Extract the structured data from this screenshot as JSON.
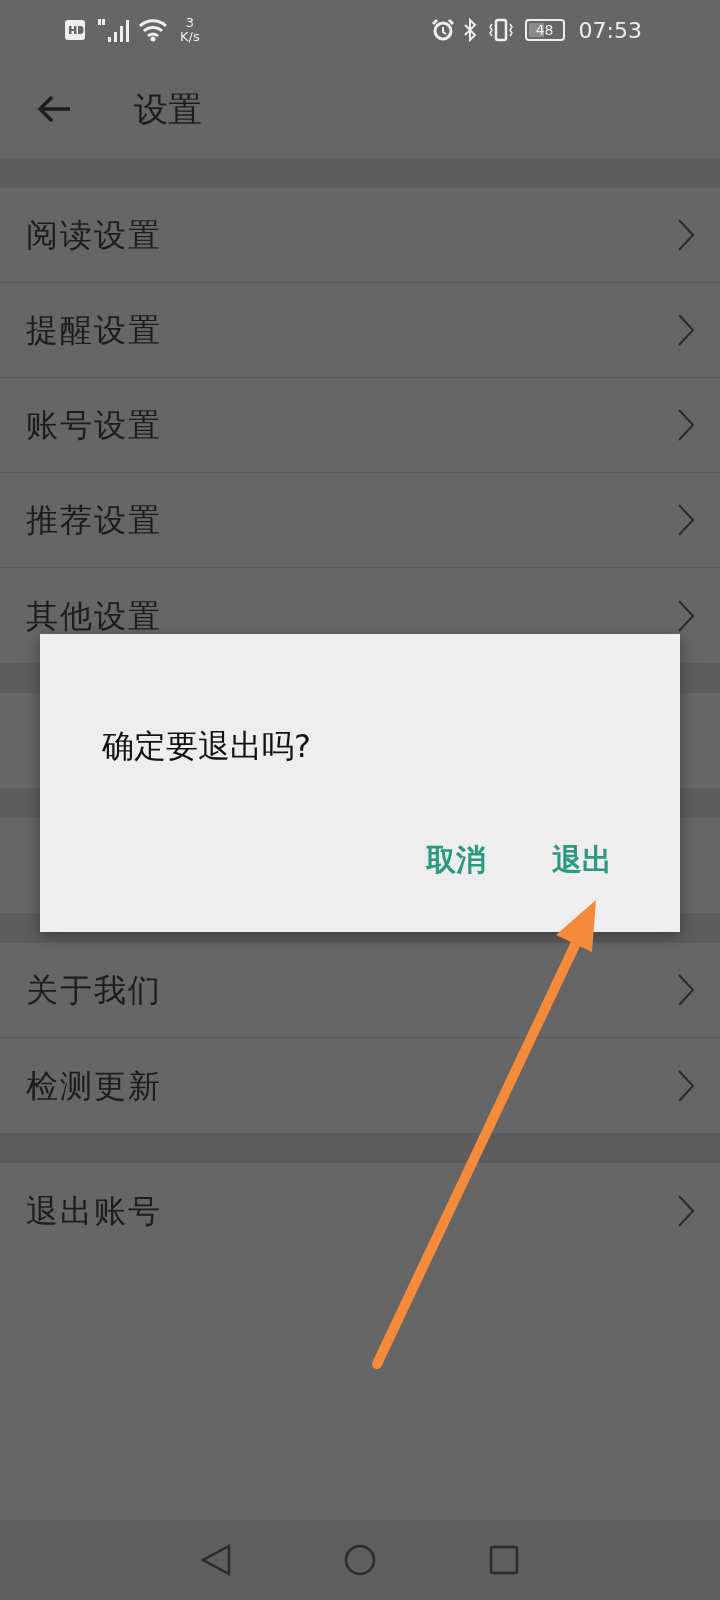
{
  "status_bar": {
    "speed_value": "3",
    "speed_unit": "K/s",
    "battery": "48",
    "time": "07:53"
  },
  "header": {
    "title": "设置"
  },
  "groups": [
    {
      "items": [
        {
          "kind": "link",
          "label": "阅读设置"
        },
        {
          "kind": "link",
          "label": "提醒设置"
        },
        {
          "kind": "link",
          "label": "账号设置"
        },
        {
          "kind": "link",
          "label": "推荐设置"
        },
        {
          "kind": "link",
          "label": "其他设置"
        }
      ]
    },
    {
      "items": [
        {
          "kind": "covered"
        }
      ]
    },
    {
      "items": [
        {
          "kind": "covered"
        }
      ]
    },
    {
      "items": [
        {
          "kind": "link",
          "label": "关于我们"
        },
        {
          "kind": "link",
          "label": "检测更新"
        }
      ]
    },
    {
      "items": [
        {
          "kind": "link",
          "label": "退出账号"
        }
      ]
    }
  ],
  "dialog": {
    "message": "确定要退出吗?",
    "buttons": [
      {
        "label": "取消"
      },
      {
        "label": "退出"
      }
    ]
  }
}
